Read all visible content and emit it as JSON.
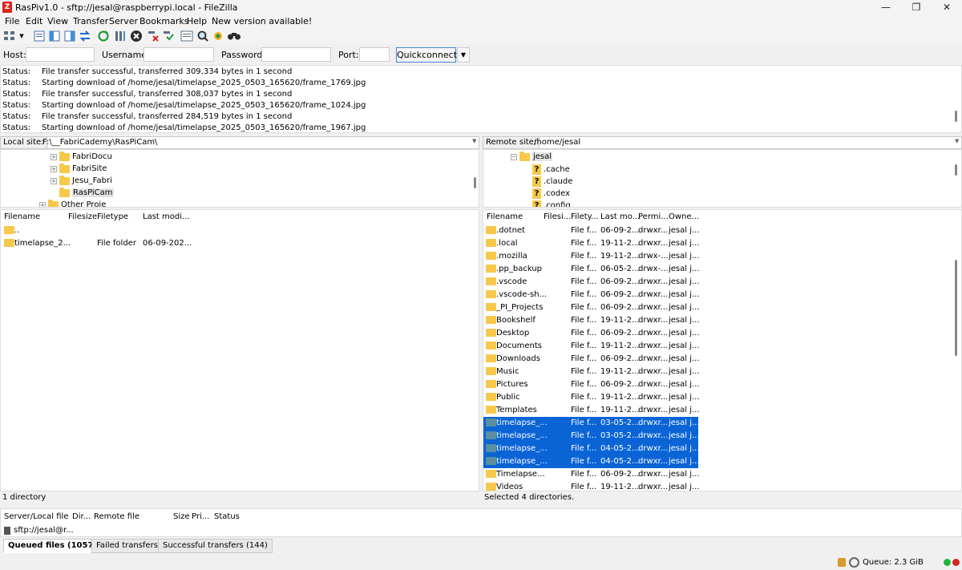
{
  "window": {
    "title": "RasPiv1.0 - sftp://jesal@raspberrypi.local - FileZilla"
  },
  "menu": [
    "File",
    "Edit",
    "View",
    "Transfer",
    "Server",
    "Bookmarks",
    "Help",
    "New version available!"
  ],
  "quickconnect": {
    "host_label": "Host:",
    "host_value": "",
    "username_label": "Username:",
    "username_value": "",
    "password_label": "Password:",
    "password_value": "",
    "port_label": "Port:",
    "port_value": "",
    "button": "Quickconnect"
  },
  "log": [
    {
      "k": "Status:",
      "v": "File transfer successful, transferred 309,334 bytes in 1 second"
    },
    {
      "k": "Status:",
      "v": "Starting download of /home/jesal/timelapse_2025_0503_165620/frame_1769.jpg"
    },
    {
      "k": "Status:",
      "v": "File transfer successful, transferred 308,037 bytes in 1 second"
    },
    {
      "k": "Status:",
      "v": "Starting download of /home/jesal/timelapse_2025_0503_165620/frame_1024.jpg"
    },
    {
      "k": "Status:",
      "v": "File transfer successful, transferred 284,519 bytes in 1 second"
    },
    {
      "k": "Status:",
      "v": "Starting download of /home/jesal/timelapse_2025_0503_165620/frame_1967.jpg"
    }
  ],
  "local": {
    "label": "Local site:",
    "path": "F:\\__FabriCademy\\RasPiCam\\",
    "tree": [
      "FabriDocu",
      "FabriSite",
      "Jesu_Fabri",
      "RasPiCam",
      "Other Proje"
    ],
    "headers": [
      "Filename",
      "Filesize",
      "Filetype",
      "Last modi..."
    ],
    "rows": [
      {
        "name": "..",
        "size": "",
        "type": "",
        "mod": ""
      },
      {
        "name": "timelapse_2...",
        "size": "",
        "type": "File folder",
        "mod": "06-09-202..."
      }
    ],
    "status": "1 directory"
  },
  "remote": {
    "label": "Remote site:",
    "path": "/home/jesal",
    "tree": [
      "jesal",
      ".cache",
      ".claude",
      ".codex",
      ".config"
    ],
    "headers": [
      "Filename",
      "Filesi...",
      "Filety...",
      "Last mo...",
      "Permi...",
      "Owne..."
    ],
    "rows": [
      {
        "name": ".dotnet",
        "type": "File f...",
        "mod": "06-09-2...",
        "perm": "drwxr...",
        "owner": "jesal j...",
        "sel": false
      },
      {
        "name": ".local",
        "type": "File f...",
        "mod": "19-11-2...",
        "perm": "drwxr...",
        "owner": "jesal j...",
        "sel": false
      },
      {
        "name": ".mozilla",
        "type": "File f...",
        "mod": "19-11-2...",
        "perm": "drwx-...",
        "owner": "jesal j...",
        "sel": false
      },
      {
        "name": ".pp_backup",
        "type": "File f...",
        "mod": "06-05-2...",
        "perm": "drwx-...",
        "owner": "jesal j...",
        "sel": false
      },
      {
        "name": ".vscode",
        "type": "File f...",
        "mod": "06-09-2...",
        "perm": "drwxr...",
        "owner": "jesal j...",
        "sel": false
      },
      {
        "name": ".vscode-sh...",
        "type": "File f...",
        "mod": "06-09-2...",
        "perm": "drwxr...",
        "owner": "jesal j...",
        "sel": false
      },
      {
        "name": "_PI_Projects",
        "type": "File f...",
        "mod": "06-09-2...",
        "perm": "drwxr...",
        "owner": "jesal j...",
        "sel": false
      },
      {
        "name": "Bookshelf",
        "type": "File f...",
        "mod": "19-11-2...",
        "perm": "drwxr...",
        "owner": "jesal j...",
        "sel": false
      },
      {
        "name": "Desktop",
        "type": "File f...",
        "mod": "06-09-2...",
        "perm": "drwxr...",
        "owner": "jesal j...",
        "sel": false
      },
      {
        "name": "Documents",
        "type": "File f...",
        "mod": "19-11-2...",
        "perm": "drwxr...",
        "owner": "jesal j...",
        "sel": false
      },
      {
        "name": "Downloads",
        "type": "File f...",
        "mod": "06-09-2...",
        "perm": "drwxr...",
        "owner": "jesal j...",
        "sel": false
      },
      {
        "name": "Music",
        "type": "File f...",
        "mod": "19-11-2...",
        "perm": "drwxr...",
        "owner": "jesal j...",
        "sel": false
      },
      {
        "name": "Pictures",
        "type": "File f...",
        "mod": "06-09-2...",
        "perm": "drwxr...",
        "owner": "jesal j...",
        "sel": false
      },
      {
        "name": "Public",
        "type": "File f...",
        "mod": "19-11-2...",
        "perm": "drwxr...",
        "owner": "jesal j...",
        "sel": false
      },
      {
        "name": "Templates",
        "type": "File f...",
        "mod": "19-11-2...",
        "perm": "drwxr...",
        "owner": "jesal j...",
        "sel": false
      },
      {
        "name": "timelapse_...",
        "type": "File f...",
        "mod": "03-05-2...",
        "perm": "drwxr...",
        "owner": "jesal j...",
        "sel": true
      },
      {
        "name": "timelapse_...",
        "type": "File f...",
        "mod": "03-05-2...",
        "perm": "drwxr...",
        "owner": "jesal j...",
        "sel": true
      },
      {
        "name": "timelapse_...",
        "type": "File f...",
        "mod": "04-05-2...",
        "perm": "drwxr...",
        "owner": "jesal j...",
        "sel": true
      },
      {
        "name": "timelapse_...",
        "type": "File f...",
        "mod": "04-05-2...",
        "perm": "drwxr...",
        "owner": "jesal j...",
        "sel": true
      },
      {
        "name": "Timelapse...",
        "type": "File f...",
        "mod": "06-09-2...",
        "perm": "drwxr...",
        "owner": "jesal j...",
        "sel": false
      },
      {
        "name": "Videos",
        "type": "File f...",
        "mod": "19-11-2...",
        "perm": "drwxr...",
        "owner": "jesal j...",
        "sel": false
      }
    ],
    "status": "Selected 4 directories."
  },
  "queue": {
    "headers": [
      "Server/Local file",
      "Dir...",
      "Remote file",
      "Size",
      "Pri...",
      "Status"
    ],
    "row": "sftp://jesal@r..."
  },
  "tabs": [
    "Queued files (10574)",
    "Failed transfers",
    "Successful transfers (144)"
  ],
  "footer": {
    "queue": "Queue: 2.3 GiB"
  },
  "colors": {
    "selection": "#0a64d6",
    "folder": "#f7c84a",
    "accent": "#3e86d8"
  }
}
